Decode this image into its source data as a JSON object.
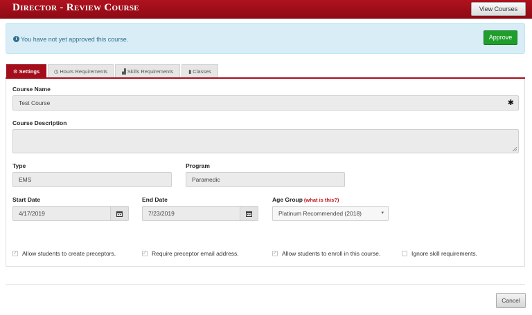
{
  "header": {
    "title": "Director - Review Course",
    "view_courses_label": "View Courses"
  },
  "alert": {
    "icon": "info-icon",
    "message": "You have not yet approved this course.",
    "approve_label": "Approve"
  },
  "tabs": [
    {
      "label": "Settings",
      "icon": "gear-icon",
      "active": true
    },
    {
      "label": "Hours Requirements",
      "icon": "clock-icon",
      "active": false
    },
    {
      "label": "Skills Requirements",
      "icon": "gavel-icon",
      "active": false
    },
    {
      "label": "Classes",
      "icon": "book-icon",
      "active": false
    }
  ],
  "form": {
    "course_name": {
      "label": "Course Name",
      "value": "Test Course"
    },
    "course_description": {
      "label": "Course Description",
      "value": ""
    },
    "type": {
      "label": "Type",
      "value": "EMS"
    },
    "program": {
      "label": "Program",
      "value": "Paramedic"
    },
    "start_date": {
      "label": "Start Date",
      "value": "4/17/2019"
    },
    "end_date": {
      "label": "End Date",
      "value": "7/23/2019"
    },
    "age_group": {
      "label": "Age Group",
      "hint": "(what is this?)",
      "value": "Platinum Recommended (2018)"
    }
  },
  "checkboxes": [
    {
      "label": "Allow students to create preceptors.",
      "checked": true
    },
    {
      "label": "Require preceptor email address.",
      "checked": true
    },
    {
      "label": "Allow students to enroll in this course.",
      "checked": true
    },
    {
      "label": "Ignore skill requirements.",
      "checked": false
    }
  ],
  "footer": {
    "cancel_label": "Cancel"
  },
  "colors": {
    "brand": "#a30e1a",
    "approve": "#1e9e2a",
    "alert_bg": "#d9edf7",
    "alert_text": "#31708f"
  }
}
